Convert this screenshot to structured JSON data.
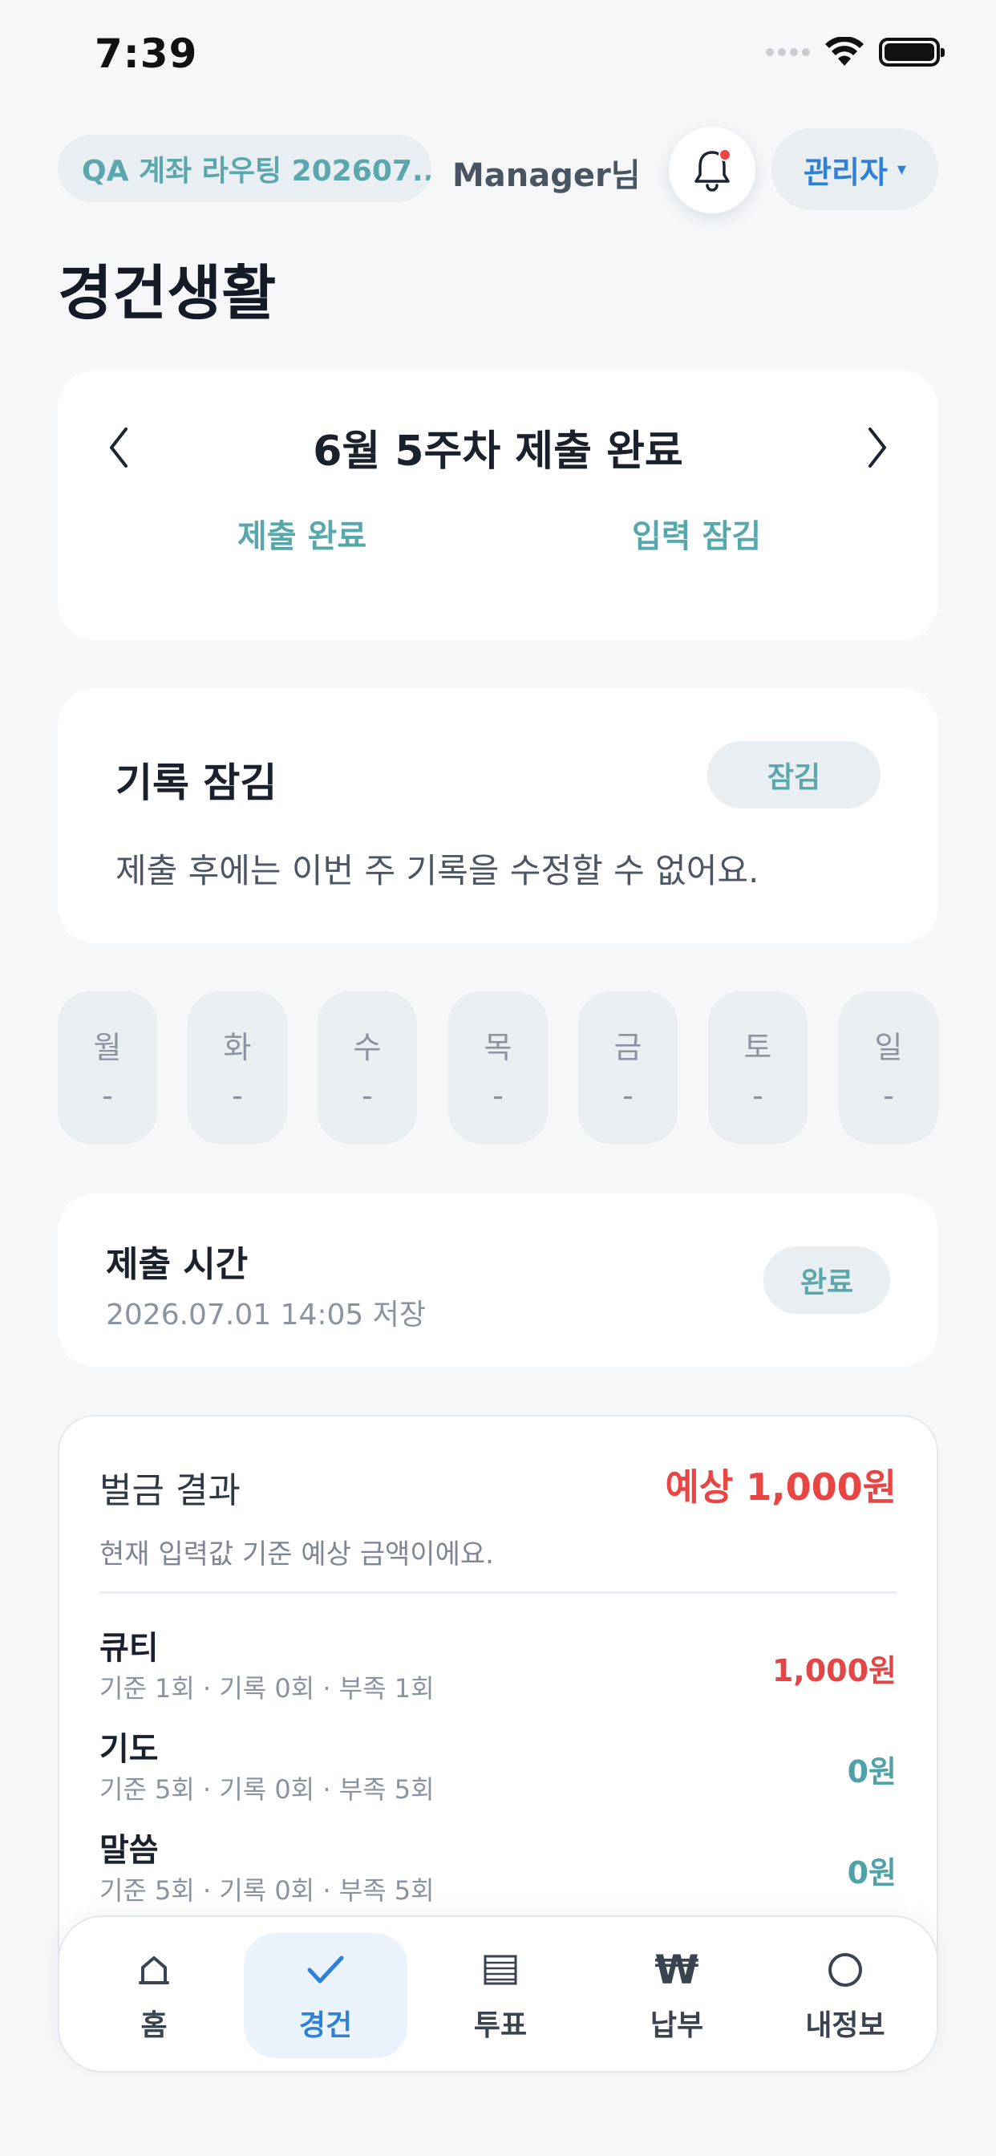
{
  "status_bar": {
    "time": "7:39"
  },
  "header": {
    "account": "QA 계좌 라우팅 202607...",
    "greeting": "Manager님",
    "role": "관리자",
    "role_caret": "▾"
  },
  "page_title": "경건생활",
  "week": {
    "title": "6월 5주차 제출 완료",
    "status_left": "제출 완료",
    "status_right": "입력 잠김"
  },
  "lock": {
    "title": "기록 잠김",
    "badge": "잠김",
    "description": "제출 후에는 이번 주 기록을 수정할 수 없어요."
  },
  "days": [
    {
      "name": "월",
      "value": "-"
    },
    {
      "name": "화",
      "value": "-"
    },
    {
      "name": "수",
      "value": "-"
    },
    {
      "name": "목",
      "value": "-"
    },
    {
      "name": "금",
      "value": "-"
    },
    {
      "name": "토",
      "value": "-"
    },
    {
      "name": "일",
      "value": "-"
    }
  ],
  "submit": {
    "title": "제출 시간",
    "timestamp": "2026.07.01 14:05 저장",
    "badge": "완료"
  },
  "fine": {
    "title": "벌금 결과",
    "total": "예상 1,000원",
    "description": "현재 입력값 기준 예상 금액이에요.",
    "rows": [
      {
        "name": "큐티",
        "meta": "기준 1회 · 기록 0회 · 부족 1회",
        "amount": "1,000원",
        "amount_color": "#e24646"
      },
      {
        "name": "기도",
        "meta": "기준 5회 · 기록 0회 · 부족 5회",
        "amount": "0원",
        "amount_color": "#4fa3a8"
      },
      {
        "name": "말씀",
        "meta": "기준 5회 · 기록 0회 · 부족 5회",
        "amount": "0원",
        "amount_color": "#4fa3a8"
      }
    ]
  },
  "nav": {
    "items": [
      {
        "label": "홈",
        "icon": "home-icon",
        "glyph": "⌂"
      },
      {
        "label": "경건",
        "icon": "check-icon",
        "glyph": "✓"
      },
      {
        "label": "투표",
        "icon": "list-icon",
        "glyph": "▤"
      },
      {
        "label": "납부",
        "icon": "won-icon",
        "glyph": "₩"
      },
      {
        "label": "내정보",
        "icon": "profile-icon",
        "glyph": "○"
      }
    ],
    "active": "경건"
  },
  "colors": {
    "accent_blue": "#2f80d8",
    "teal": "#56a8ac",
    "red": "#ea4545",
    "background": "#f5f7f9"
  }
}
